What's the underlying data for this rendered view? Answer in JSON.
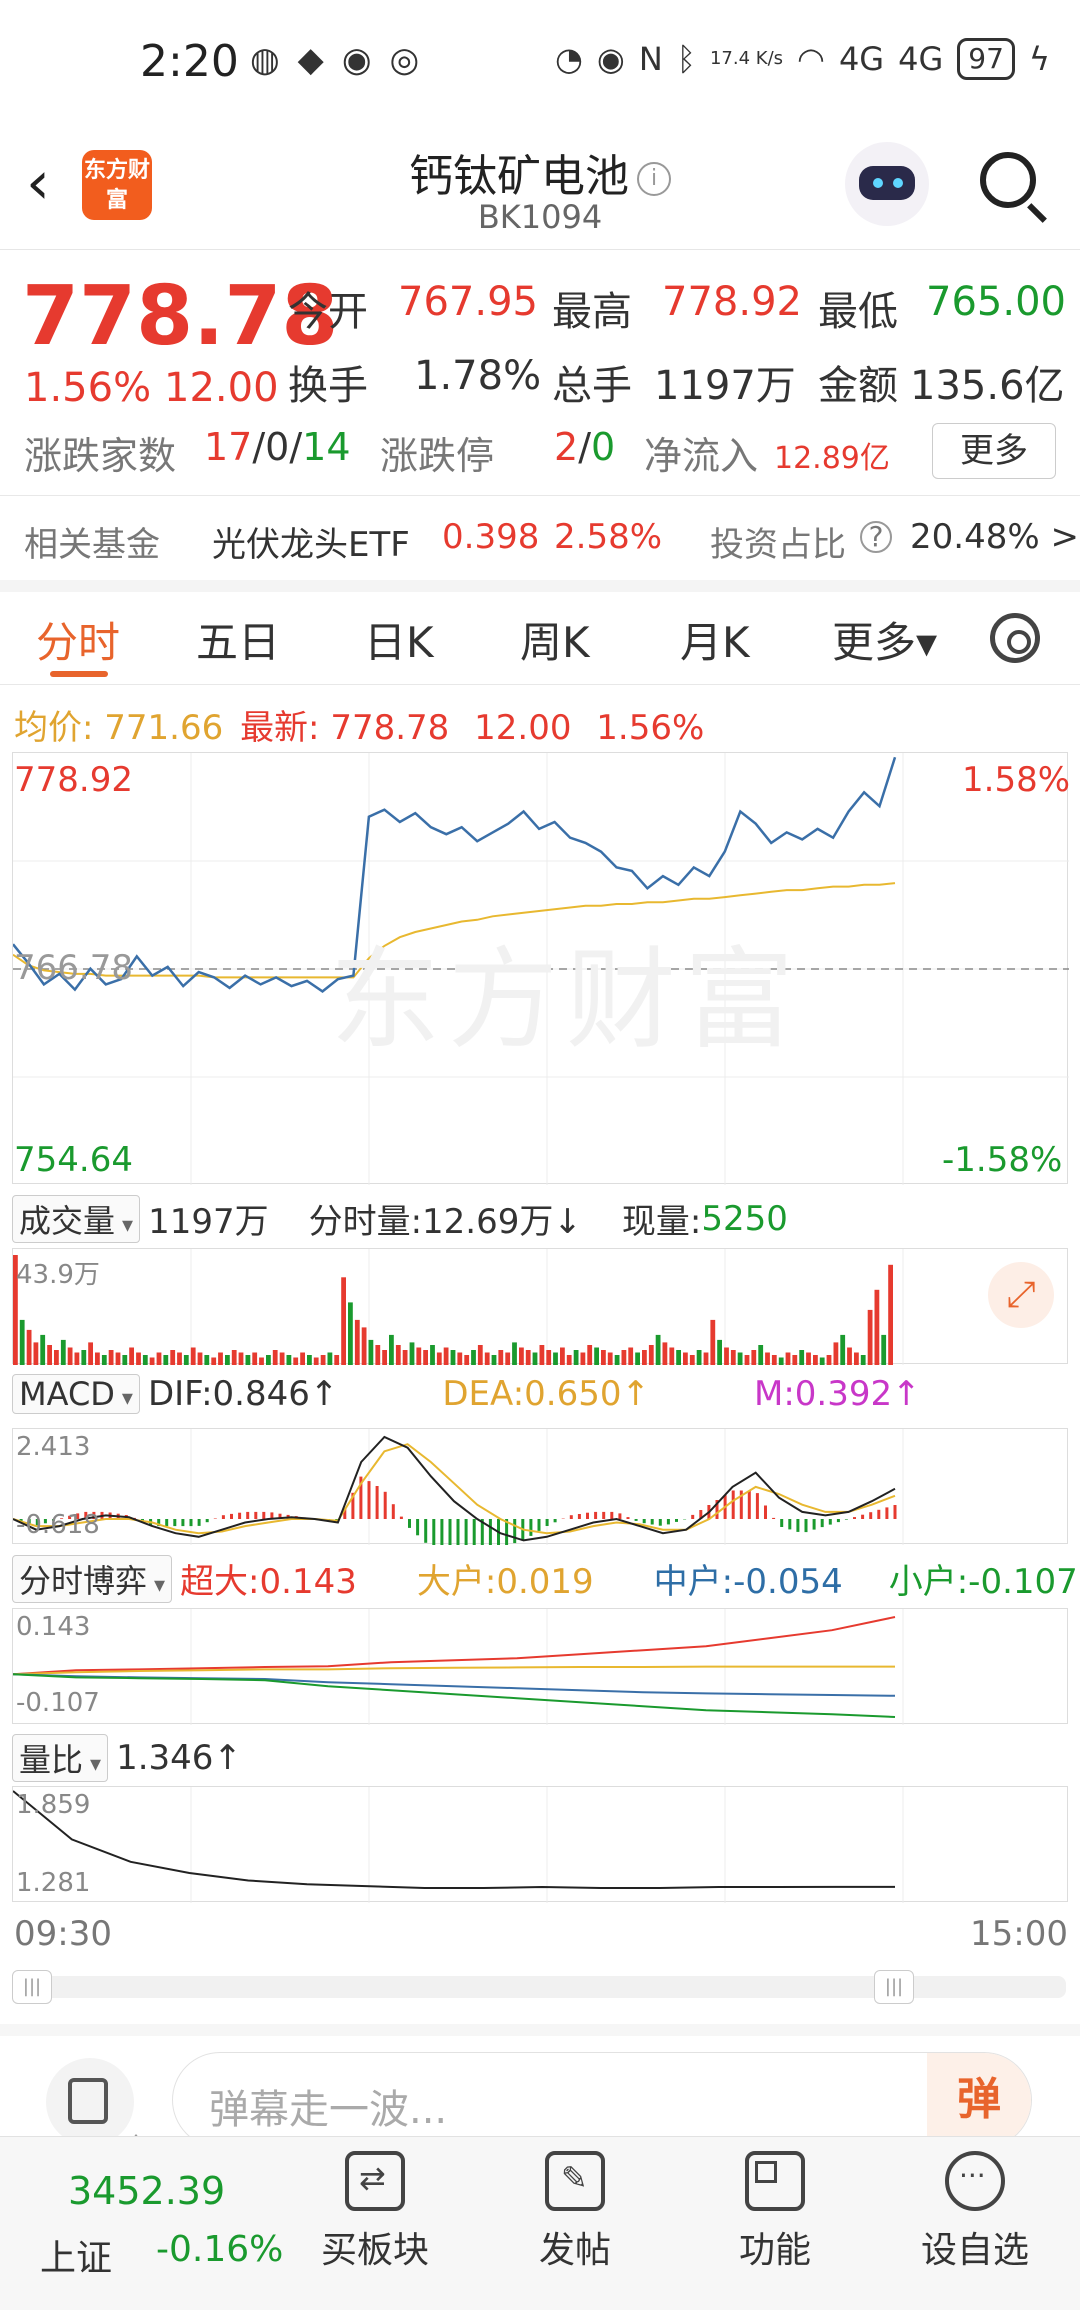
{
  "status_bar": {
    "time": "2:20",
    "net_speed": "17.4 K/s",
    "signal1": "4G",
    "signal2": "4G",
    "battery": "97"
  },
  "header": {
    "logo_text": "东方财富",
    "title": "钙钛矿电池",
    "code": "BK1094"
  },
  "quote": {
    "price": "778.78",
    "change_pct": "1.56%",
    "change": "12.00",
    "open_label": "今开",
    "open": "767.95",
    "high_label": "最高",
    "high": "778.92",
    "low_label": "最低",
    "low": "765.00",
    "turnover_label": "换手",
    "turnover": "1.78%",
    "volume_label": "总手",
    "volume": "1197万",
    "amount_label": "金额",
    "amount": "135.6亿",
    "breadth_label": "涨跌家数",
    "up": "17",
    "flat": "0",
    "down": "14",
    "limit_label": "涨跌停",
    "limit_up": "2",
    "limit_down": "0",
    "inflow_label": "净流入",
    "inflow": "12.89亿",
    "more_button": "更多",
    "sep": "/"
  },
  "fund": {
    "label": "相关基金",
    "name": "光伏龙头ETF",
    "price": "0.398",
    "change": "2.58%",
    "ratio_label": "投资占比",
    "ratio": "20.48% >"
  },
  "tabs": [
    "分时",
    "五日",
    "日K",
    "周K",
    "月K",
    "更多▾"
  ],
  "avg_row": {
    "avg_label": "均价:",
    "avg": "771.66",
    "latest_label": "最新:",
    "latest": "778.78",
    "change": "12.00",
    "pct": "1.56%"
  },
  "price_chart": {
    "top": "778.92",
    "mid": "766.78",
    "bottom": "754.64",
    "top_pct": "1.58%",
    "bottom_pct": "-1.58%",
    "watermark": "东方财富"
  },
  "volume_row": {
    "selector": "成交量",
    "total": "1197万",
    "per_min": "分时量:12.69万↓",
    "now_label": "现量:",
    "now": "5250",
    "max": "43.9万"
  },
  "macd_row": {
    "selector": "MACD",
    "dif": "DIF:0.846↑",
    "dea": "DEA:0.650↑",
    "m": "M:0.392↑",
    "max": "2.413",
    "min": "-0.618"
  },
  "fund_flow_row": {
    "selector": "分时博弈",
    "super": "超大:0.143",
    "large": "大户:0.019",
    "medium": "中户:-0.054",
    "small": "小户:-0.107",
    "max": "0.143",
    "min": "-0.107"
  },
  "ratio_row": {
    "selector": "量比",
    "value": "1.346↑",
    "max": "1.859",
    "min": "1.281"
  },
  "time_axis": {
    "start": "09:30",
    "end": "15:00"
  },
  "danmaku": {
    "placeholder": "弹幕走一波...",
    "button": "弹"
  },
  "bottom_bar": {
    "index_value": "3452.39",
    "index_name": "上证",
    "index_change": "-0.16%",
    "items": [
      "买板块",
      "发帖",
      "功能",
      "设自选"
    ]
  },
  "colors": {
    "up": "#e63a2f",
    "down": "#1a9a2e",
    "price_line": "#3a6fa8",
    "avg_line": "#e8b830",
    "accent": "#e8642c"
  },
  "chart_data": [
    {
      "type": "line",
      "xlabel": "",
      "ylabel": "",
      "x_range": [
        "09:30",
        "15:00"
      ],
      "ylim": [
        754.64,
        778.92
      ],
      "reference": 766.78,
      "series": [
        {
          "values": [
            768.2,
            767.1,
            765.9,
            766.5,
            765.6,
            766.8,
            765.9,
            766.2,
            767.5,
            766.4,
            766.9,
            765.8,
            766.6,
            766.3,
            765.7,
            766.4,
            765.9,
            766.3,
            765.8,
            766.1,
            765.5,
            766.2,
            766.4,
            775.5,
            775.9,
            775.2,
            775.7,
            774.9,
            774.5,
            774.9,
            774.1,
            774.6,
            775.1,
            775.8,
            774.8,
            775.2,
            774.3,
            774.0,
            773.5,
            772.6,
            772.4,
            771.4,
            772.1,
            771.6,
            772.6,
            772.1,
            773.5,
            775.8,
            775.1,
            774.0,
            774.6,
            774.2,
            774.8,
            774.3,
            775.8,
            776.9,
            776.1,
            778.9
          ]
        },
        {
          "values": [
            767.6,
            767.0,
            766.7,
            766.6,
            766.5,
            766.5,
            766.4,
            766.4,
            766.4,
            766.4,
            766.4,
            766.4,
            766.4,
            766.3,
            766.3,
            766.3,
            766.3,
            766.3,
            766.3,
            766.3,
            766.3,
            766.3,
            766.3,
            767.4,
            768.1,
            768.6,
            768.9,
            769.1,
            769.3,
            769.5,
            769.6,
            769.8,
            769.9,
            770.0,
            770.1,
            770.2,
            770.3,
            770.4,
            770.4,
            770.5,
            770.5,
            770.6,
            770.6,
            770.7,
            770.8,
            770.8,
            770.9,
            771.0,
            771.1,
            771.2,
            771.3,
            771.3,
            771.4,
            771.5,
            771.5,
            771.6,
            771.6,
            771.7
          ]
        }
      ]
    },
    {
      "type": "bar",
      "xlabel": "",
      "ylabel": "",
      "ylim": [
        0,
        43.9
      ],
      "values": [
        43.9,
        18,
        14,
        9,
        12,
        8,
        6,
        10,
        7,
        5,
        6,
        9,
        5,
        4,
        6,
        5,
        4,
        7,
        5,
        4,
        3,
        5,
        4,
        6,
        5,
        4,
        7,
        5,
        4,
        3,
        5,
        4,
        6,
        5,
        4,
        5,
        3,
        4,
        6,
        5,
        4,
        3,
        5,
        4,
        3,
        4,
        5,
        4,
        35,
        25,
        18,
        15,
        10,
        8,
        6,
        12,
        8,
        6,
        9,
        7,
        6,
        8,
        5,
        7,
        6,
        5,
        4,
        6,
        8,
        5,
        4,
        6,
        5,
        9,
        7,
        6,
        5,
        8,
        6,
        5,
        7,
        4,
        6,
        5,
        8,
        7,
        6,
        5,
        4,
        6,
        7,
        5,
        6,
        8,
        12,
        9,
        7,
        6,
        5,
        4,
        6,
        5,
        18,
        10,
        7,
        6,
        5,
        4,
        6,
        8,
        5,
        4,
        3,
        5,
        4,
        6,
        5,
        4,
        3,
        4,
        9,
        12,
        7,
        5,
        4,
        22,
        30,
        12,
        40
      ]
    },
    {
      "type": "line",
      "xlabel": "",
      "ylabel": "",
      "ylim": [
        -0.618,
        2.413
      ],
      "series": [
        {
          "name": "DIF",
          "values": [
            0.0,
            -0.3,
            -0.2,
            0.0,
            0.1,
            0.05,
            -0.2,
            -0.4,
            -0.5,
            -0.3,
            -0.1,
            0.0,
            0.05,
            0.0,
            -0.1,
            1.6,
            2.3,
            2.0,
            1.2,
            0.5,
            0.0,
            -0.4,
            -0.6,
            -0.5,
            -0.3,
            -0.1,
            0.0,
            -0.2,
            -0.4,
            -0.3,
            0.2,
            0.9,
            1.3,
            0.6,
            0.2,
            0.1,
            0.2,
            0.5,
            0.846
          ]
        },
        {
          "name": "DEA",
          "values": [
            0.0,
            -0.2,
            -0.2,
            -0.1,
            0.0,
            0.0,
            -0.1,
            -0.3,
            -0.4,
            -0.35,
            -0.2,
            -0.1,
            0.0,
            0.0,
            -0.05,
            1.0,
            1.9,
            2.1,
            1.6,
            1.0,
            0.4,
            0.0,
            -0.3,
            -0.4,
            -0.35,
            -0.2,
            -0.1,
            -0.15,
            -0.3,
            -0.3,
            0.0,
            0.5,
            0.9,
            0.7,
            0.4,
            0.2,
            0.2,
            0.4,
            0.65
          ]
        }
      ]
    },
    {
      "type": "line",
      "xlabel": "",
      "ylabel": "",
      "ylim": [
        -0.107,
        0.143
      ],
      "series": [
        {
          "name": "超大",
          "values": [
            0.0,
            0.01,
            0.012,
            0.015,
            0.018,
            0.02,
            0.03,
            0.035,
            0.04,
            0.05,
            0.06,
            0.07,
            0.09,
            0.11,
            0.143
          ]
        },
        {
          "name": "大户",
          "values": [
            0.0,
            0.005,
            0.008,
            0.01,
            0.012,
            0.012,
            0.015,
            0.016,
            0.017,
            0.018,
            0.018,
            0.019,
            0.019,
            0.019,
            0.019
          ]
        },
        {
          "name": "中户",
          "values": [
            0.0,
            -0.005,
            -0.008,
            -0.01,
            -0.012,
            -0.02,
            -0.025,
            -0.03,
            -0.035,
            -0.04,
            -0.045,
            -0.048,
            -0.05,
            -0.052,
            -0.054
          ]
        },
        {
          "name": "小户",
          "values": [
            0.0,
            -0.008,
            -0.01,
            -0.012,
            -0.015,
            -0.03,
            -0.04,
            -0.05,
            -0.06,
            -0.07,
            -0.08,
            -0.09,
            -0.095,
            -0.1,
            -0.107
          ]
        }
      ]
    },
    {
      "type": "line",
      "xlabel": "",
      "ylabel": "",
      "ylim": [
        1.281,
        1.859
      ],
      "series": [
        {
          "name": "量比",
          "values": [
            1.859,
            1.6,
            1.48,
            1.42,
            1.38,
            1.36,
            1.35,
            1.34,
            1.34,
            1.345,
            1.34,
            1.34,
            1.345,
            1.345,
            1.346,
            1.346
          ]
        }
      ]
    }
  ]
}
